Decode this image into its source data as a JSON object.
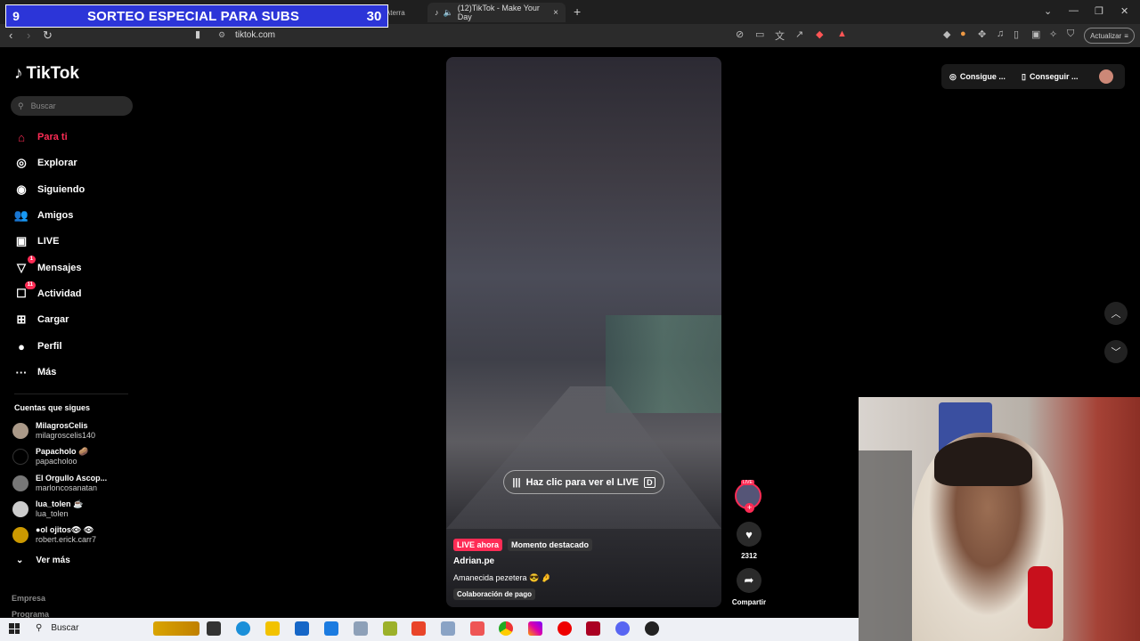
{
  "overlay": {
    "number": "9",
    "text": "SORTEO ESPECIAL PARA SUBS",
    "count": "30"
  },
  "tabs": {
    "background_tab": "(206) Los 20 Casos más Aterra",
    "active_tab": "(12)TikTok - Make Your Day",
    "close": "×",
    "new": "+"
  },
  "address": {
    "url": "tiktok.com",
    "update_label": "Actualizar"
  },
  "brand": {
    "name": "TikTok"
  },
  "search": {
    "placeholder": "Buscar"
  },
  "nav": [
    {
      "label": "Para ti",
      "icon": "home-icon"
    },
    {
      "label": "Explorar",
      "icon": "compass-icon"
    },
    {
      "label": "Siguiendo",
      "icon": "following-icon"
    },
    {
      "label": "Amigos",
      "icon": "friends-icon"
    },
    {
      "label": "LIVE",
      "icon": "live-icon"
    },
    {
      "label": "Mensajes",
      "icon": "messages-icon",
      "badge": "1"
    },
    {
      "label": "Actividad",
      "icon": "activity-icon",
      "badge": "11"
    },
    {
      "label": "Cargar",
      "icon": "upload-icon"
    },
    {
      "label": "Perfil",
      "icon": "profile-icon"
    },
    {
      "label": "Más",
      "icon": "more-icon"
    }
  ],
  "following_title": "Cuentas que sigues",
  "following": [
    {
      "name": "MilagrosCelis",
      "handle": "milagroscelis140"
    },
    {
      "name": "Papacholo 🥔",
      "handle": "papacholoo"
    },
    {
      "name": "El Orgullo Ascop...",
      "handle": "marloncosanatan"
    },
    {
      "name": "lua_tolen ☕",
      "handle": "lua_tolen"
    },
    {
      "name": "●ol ojitos👁 👁",
      "handle": "robert.erick.carr7"
    }
  ],
  "see_more": "Ver más",
  "footer": [
    "Empresa",
    "Programa"
  ],
  "video": {
    "live_button": "Haz clic para ver el LIVE",
    "live_key": "D",
    "live_tag": "LIVE ahora",
    "moment": "Momento destacado",
    "author": "Adrian.pe",
    "description": "Amanecida pezetera 😎 🤌",
    "collab": "Colaboración de pago",
    "avatar_live": "LIVE",
    "likes": "2312",
    "share_label": "Compartir"
  },
  "top_right": {
    "coins": "Consigue ...",
    "app": "Conseguir ..."
  },
  "taskbar": {
    "search": "Buscar"
  }
}
